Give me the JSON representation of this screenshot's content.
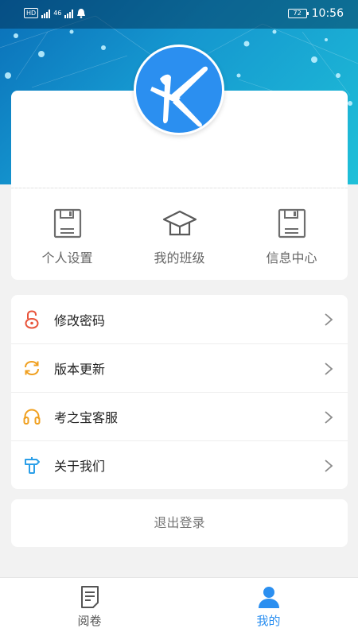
{
  "status_bar": {
    "hd_label": "HD",
    "network_label": "46",
    "battery_level": "72",
    "time": "10:56"
  },
  "profile": {
    "avatar_letter": "K"
  },
  "quick_actions": [
    {
      "label": "个人设置",
      "icon": "floppy-disk-icon"
    },
    {
      "label": "我的班级",
      "icon": "graduation-cap-icon"
    },
    {
      "label": "信息中心",
      "icon": "floppy-disk-icon"
    }
  ],
  "menu": [
    {
      "label": "修改密码",
      "icon": "lock-icon",
      "color": "#e8533a"
    },
    {
      "label": "版本更新",
      "icon": "refresh-icon",
      "color": "#f0a020"
    },
    {
      "label": "考之宝客服",
      "icon": "headset-icon",
      "color": "#f0a020"
    },
    {
      "label": "关于我们",
      "icon": "signpost-icon",
      "color": "#2b9fe8"
    }
  ],
  "logout_label": "退出登录",
  "tabs": [
    {
      "label": "阅卷",
      "icon": "document-icon",
      "active": false
    },
    {
      "label": "我的",
      "icon": "user-icon",
      "active": true
    }
  ],
  "colors": {
    "accent": "#2b8ff0",
    "hero_start": "#0a6fb8",
    "hero_end": "#1fc0d8"
  }
}
